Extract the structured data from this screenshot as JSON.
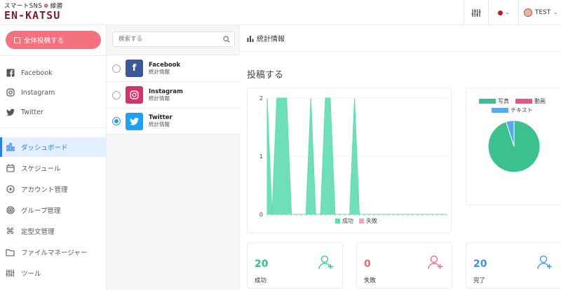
{
  "header": {
    "logo_top": "スマートSNS",
    "logo_top2": "縁勝",
    "logo_main": "EN-KATSU",
    "user": "TEST"
  },
  "sidebar": {
    "post_all": "全体投稿する",
    "social": [
      {
        "label": "Facebook",
        "icon": "facebook-icon"
      },
      {
        "label": "Instagram",
        "icon": "instagram-icon"
      },
      {
        "label": "Twitter",
        "icon": "twitter-icon"
      }
    ],
    "nav": [
      {
        "label": "ダッシュボード",
        "icon": "bar-chart-icon",
        "active": true
      },
      {
        "label": "スケジュール",
        "icon": "calendar-icon"
      },
      {
        "label": "アカウント管理",
        "icon": "plus-circle-icon"
      },
      {
        "label": "グループ管理",
        "icon": "target-icon"
      },
      {
        "label": "定型文管理",
        "icon": "command-icon"
      },
      {
        "label": "ファイルマネージャー",
        "icon": "folder-icon"
      },
      {
        "label": "ツール",
        "icon": "sliders-icon"
      }
    ]
  },
  "accounts": {
    "search_placeholder": "検索する",
    "items": [
      {
        "name": "Facebook",
        "sub": "統計情報",
        "selected": false,
        "color": "#3b5998"
      },
      {
        "name": "Instagram",
        "sub": "統計情報",
        "selected": false,
        "color": "#d6336c"
      },
      {
        "name": "Twitter",
        "sub": "統計情報",
        "selected": true,
        "color": "#1da1f2"
      }
    ]
  },
  "main": {
    "header_title": "統計情報",
    "section_title": "投稿する"
  },
  "chart_data": [
    {
      "type": "area",
      "ylim": [
        0,
        2
      ],
      "yticks": [
        "0",
        "1",
        "2"
      ],
      "x": [
        0,
        1,
        2,
        3,
        4,
        5,
        6,
        7,
        8,
        9,
        10,
        11,
        12,
        13,
        14,
        15,
        16,
        17,
        18,
        19,
        20,
        21,
        22,
        23,
        24,
        25,
        26,
        27,
        28,
        29,
        30,
        31,
        32,
        33,
        34,
        35,
        36,
        37
      ],
      "series": [
        {
          "name": "成功",
          "color": "#5fdcb3",
          "values": [
            2,
            0,
            2,
            2,
            2,
            0,
            0,
            0,
            0,
            2,
            0,
            0,
            2,
            2,
            0,
            0,
            0,
            0,
            2,
            0,
            0,
            0,
            0,
            0,
            0,
            0,
            0,
            0,
            0,
            0,
            0,
            0,
            0,
            0,
            0,
            0,
            0,
            0
          ]
        },
        {
          "name": "失敗",
          "color": "#f5a6b8",
          "values": [
            0,
            0,
            0,
            0,
            0,
            0,
            0,
            0,
            0,
            0,
            0,
            0,
            0,
            0,
            0,
            0,
            0,
            0,
            0,
            0,
            0,
            0,
            0,
            0,
            0,
            0,
            0,
            0,
            0,
            0,
            0,
            0,
            0,
            0,
            0,
            0,
            0,
            0
          ]
        }
      ]
    },
    {
      "type": "pie",
      "categories": [
        "写真",
        "動画",
        "テキスト"
      ],
      "values": [
        95,
        0,
        5
      ],
      "colors": [
        "#3cc08e",
        "#f0508a",
        "#56a8f0"
      ]
    }
  ],
  "stats": [
    {
      "value": "20",
      "label": "成功",
      "color": "#2fc388"
    },
    {
      "value": "0",
      "label": "失敗",
      "color": "#f0637a"
    },
    {
      "value": "20",
      "label": "完了",
      "color": "#3d8fe6"
    }
  ]
}
